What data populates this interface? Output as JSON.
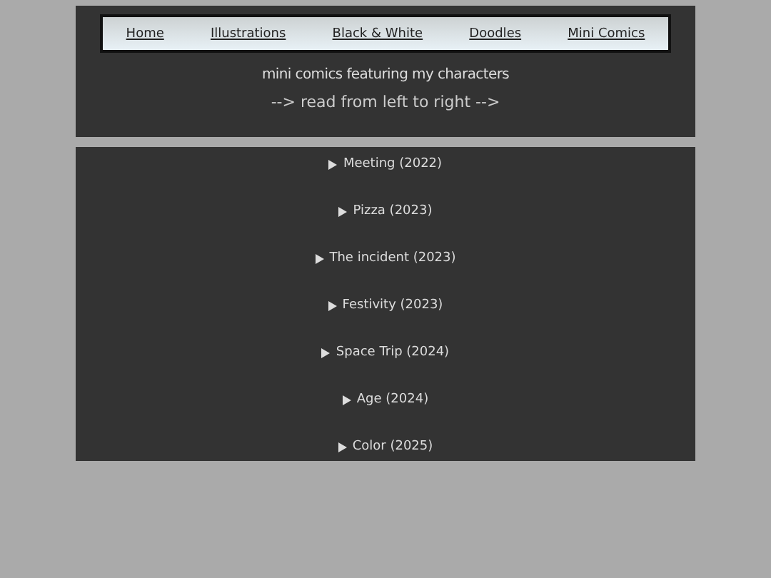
{
  "nav": [
    {
      "label": "Home"
    },
    {
      "label": "Illustrations"
    },
    {
      "label": "Black & White"
    },
    {
      "label": "Doodles"
    },
    {
      "label": "Mini Comics"
    }
  ],
  "subtitle": "mini comics featuring my characters",
  "hint": "--> read from left to right -->",
  "comics": [
    {
      "title": "Meeting (2022)",
      "expanded": false
    },
    {
      "title": "Pizza (2023)",
      "expanded": false
    },
    {
      "title": "The incident (2023)",
      "expanded": false
    },
    {
      "title": "Festivity (2023)",
      "expanded": false
    },
    {
      "title": "Space Trip (2024)",
      "expanded": false
    },
    {
      "title": "Age (2024)",
      "expanded": false
    },
    {
      "title": "Color (2025)",
      "expanded": false
    }
  ]
}
